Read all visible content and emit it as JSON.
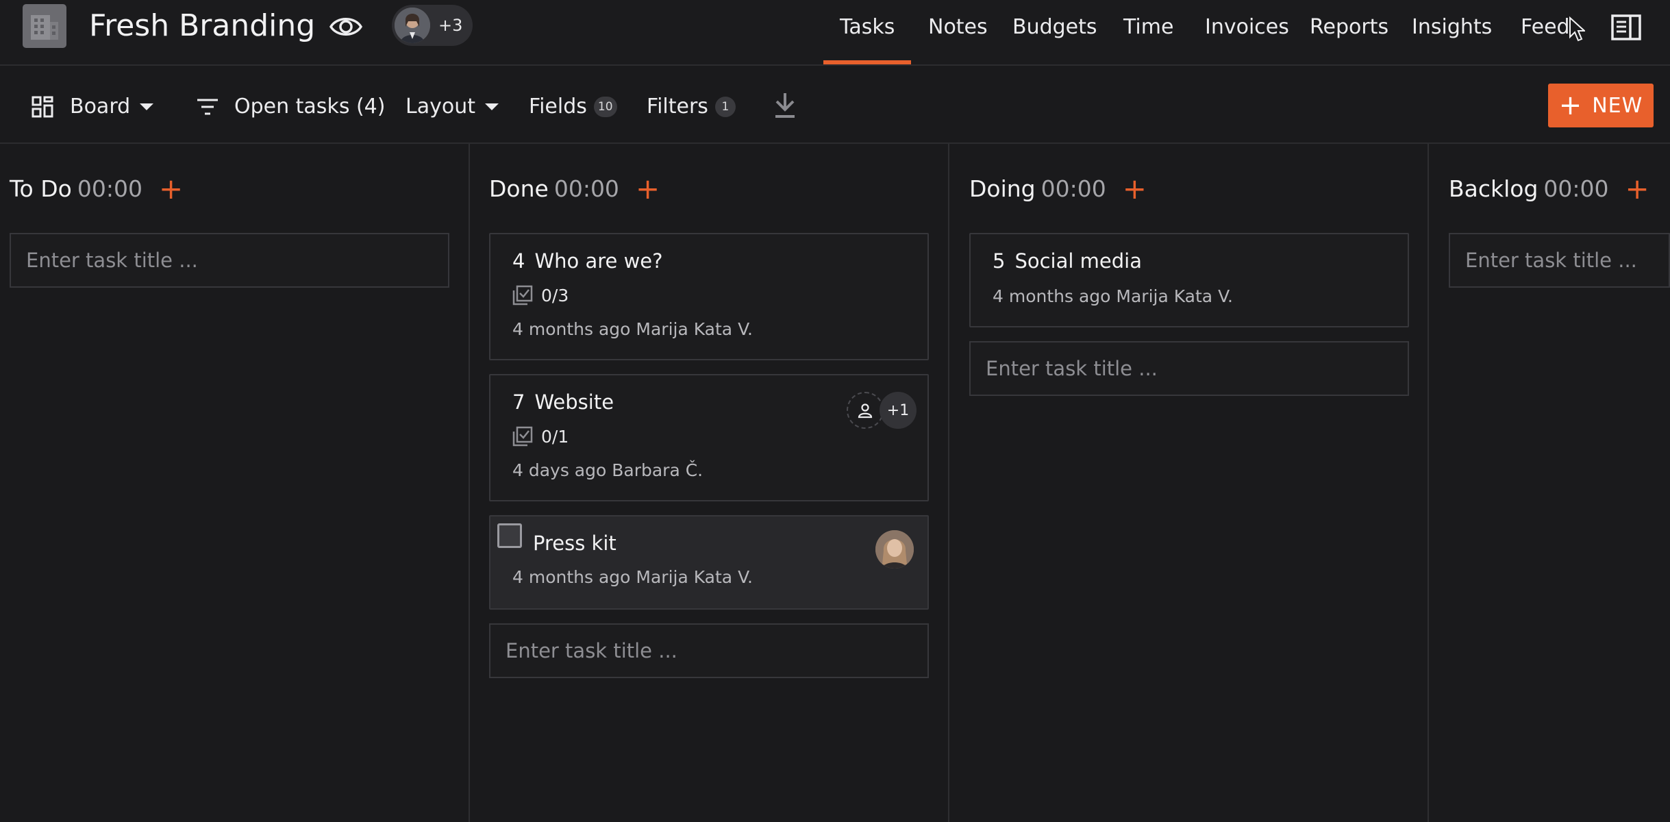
{
  "app": {
    "project_title": "Fresh Branding",
    "watchers_more": "+3"
  },
  "nav": {
    "items": [
      "Tasks",
      "Notes",
      "Budgets",
      "Time",
      "Invoices",
      "Reports",
      "Insights",
      "Feed"
    ],
    "active": "Tasks"
  },
  "toolbar": {
    "view": "Board",
    "filter_summary": "Open tasks (4)",
    "layout": "Layout",
    "fields": "Fields",
    "fields_count": "10",
    "filters": "Filters",
    "filters_count": "1",
    "new_label": "NEW"
  },
  "colors": {
    "accent": "#e8602c",
    "background": "#1a1a1c",
    "card_border": "#37373b"
  },
  "board": {
    "placeholder": "Enter task title ...",
    "columns": [
      {
        "name": "To Do",
        "time": "00:00",
        "tasks": []
      },
      {
        "name": "Done",
        "time": "00:00",
        "tasks": [
          {
            "number": "4",
            "title": "Who are we?",
            "checklist": "0/3",
            "meta": "4 months ago Marija Kata V."
          },
          {
            "number": "7",
            "title": "Website",
            "checklist": "0/1",
            "meta": "4 days ago Barbara Č.",
            "assignees_more": "+1"
          },
          {
            "number": "",
            "title": "Press kit",
            "meta": "4 months ago Marija Kata V.",
            "has_checkbox": true,
            "has_avatar": true
          }
        ]
      },
      {
        "name": "Doing",
        "time": "00:00",
        "tasks": [
          {
            "number": "5",
            "title": "Social media",
            "meta": "4 months ago Marija Kata V."
          }
        ]
      },
      {
        "name": "Backlog",
        "time": "00:00",
        "tasks": []
      }
    ]
  }
}
